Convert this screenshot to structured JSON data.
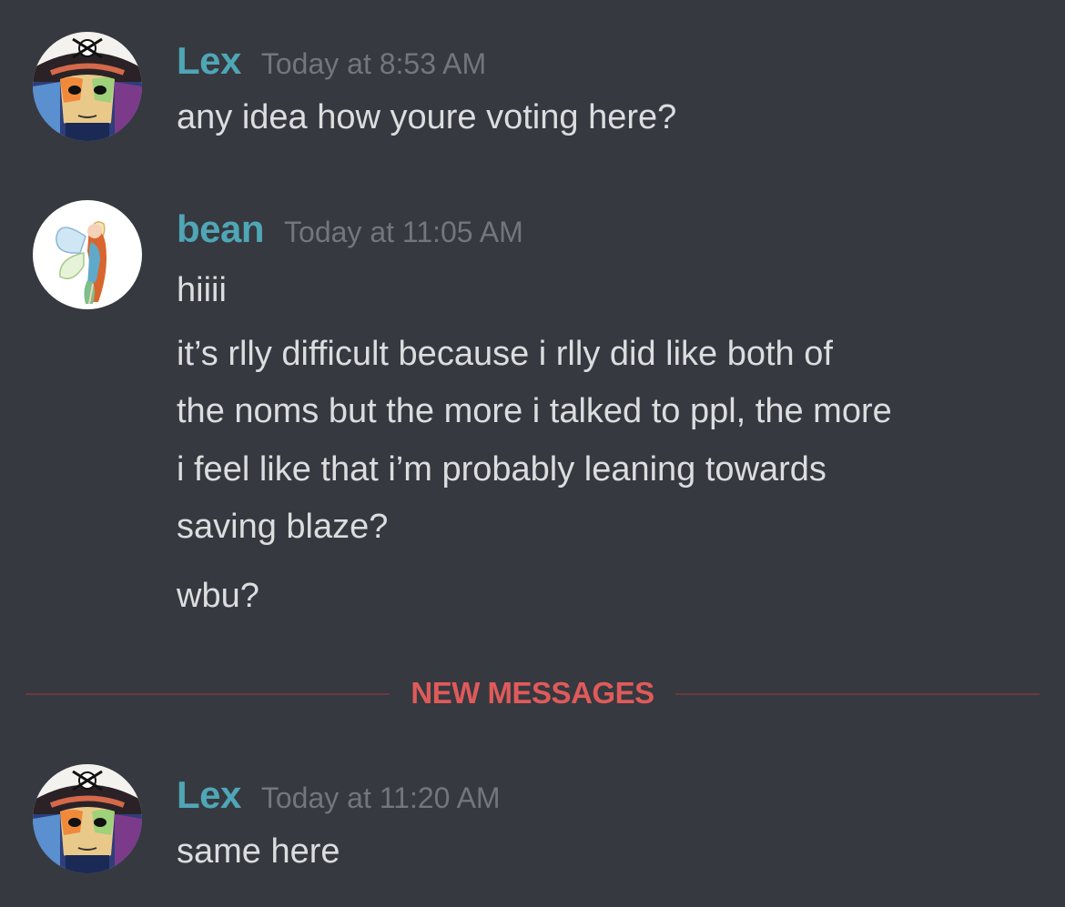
{
  "messages": [
    {
      "username": "Lex",
      "timestamp": "Today at 8:53 AM",
      "lines": [
        "any idea how youre voting here?"
      ]
    },
    {
      "username": "bean",
      "timestamp": "Today at 11:05 AM",
      "lines": [
        "hiiii",
        "it’s rlly difficult because i rlly did like both of",
        "the noms but the more i talked to ppl, the more",
        "i feel like that i’m probably leaning towards",
        "saving blaze?",
        "wbu?"
      ]
    },
    {
      "username": "Lex",
      "timestamp": "Today at 11:20 AM",
      "lines": [
        "same here"
      ]
    }
  ],
  "divider": {
    "label": "NEW MESSAGES"
  },
  "colors": {
    "background": "#36393f",
    "username": "#4fa6b6",
    "timestamp": "#72767d",
    "message_text": "#dcddde",
    "new_messages": "#e05a5a"
  },
  "icons": {
    "lex_avatar": "pirate-skull-avatar-icon",
    "bean_avatar": "fairy-avatar-icon"
  }
}
